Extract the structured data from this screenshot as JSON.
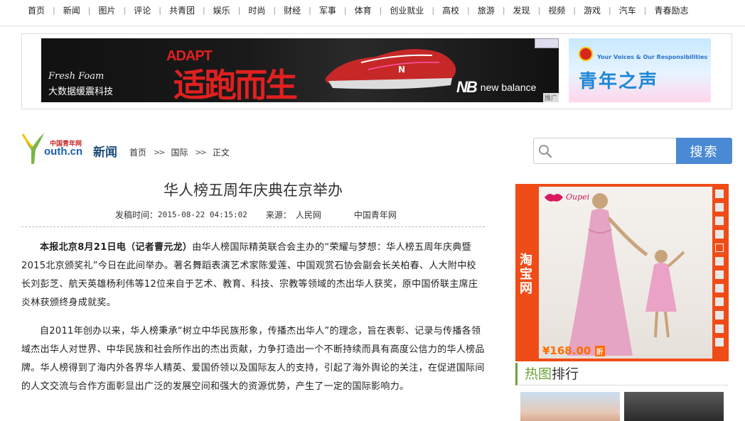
{
  "nav": {
    "items": [
      "首页",
      "新闻",
      "图片",
      "评论",
      "共青团",
      "娱乐",
      "时尚",
      "财经",
      "军事",
      "体育",
      "创业就业",
      "高校",
      "旅游",
      "发现",
      "视频",
      "游戏",
      "汽车",
      "青春励志"
    ]
  },
  "banner": {
    "main_ad": {
      "line1": "Fresh Foam",
      "line2": "大数据缓震科技",
      "adapt": "ADAPT",
      "slogan": "适跑而生",
      "brand": "new balance",
      "tag": "推广"
    },
    "side_ad": {
      "english": "Your Voices & Our Responsibilities",
      "title": "青年之声"
    }
  },
  "logo": {
    "top": "中国青年网",
    "text": "outh.cn"
  },
  "section": {
    "title": "新闻"
  },
  "breadcrumb": {
    "home": "首页",
    "sep": ">>",
    "section": "国际",
    "current": "正文"
  },
  "search": {
    "placeholder": "",
    "button": "搜索"
  },
  "article": {
    "title": "华人榜五周年庆典在京举办",
    "meta": {
      "time_label": "发稿时间：",
      "time": "2015-08-22 04:15:02",
      "source_label": "来源：",
      "source": "人民网",
      "site": "中国青年网"
    },
    "p1_lead": "本报北京8月21日电（记者曹元龙）",
    "p1_rest": "由华人榜国际精英联合会主办的“荣耀与梦想：华人榜五周年庆典暨2015北京颁奖礼”今日在此间举办。著名舞蹈表演艺术家陈爱莲、中国观赏石协会副会长关柏春、人大附中校长刘彭芝、航天英雄杨利伟等12位来自于艺术、教育、科技、宗教等领域的杰出华人获奖，原中国侨联主席庄炎林获颁终身成就奖。",
    "p2": "自2011年创办以来，华人榜秉承“树立中华民族形象，传播杰出华人”的理念，旨在表彰、记录与传播各领域杰出华人对世界、中华民族和社会所作出的杰出贡献，力争打造出一个不断持续而具有高度公信力的华人榜品牌。华人榜得到了海内外各界华人精英、爱国侨领以及国际友人的支持，引起了海外舆论的关注，在促进国际间的人文交流与合作方面彰显出广泛的发展空间和强大的资源优势，产生了一定的国际影响力。"
  },
  "taobao_ad": {
    "label": "淘宝网",
    "brand": "Oupei",
    "price": "¥168.00",
    "price_tag": "折",
    "active_index": 4,
    "dot_count": 12
  },
  "hot": {
    "green": "热图",
    "rest": "排行"
  },
  "colors": {
    "accent_blue": "#4a8ad4",
    "taobao_orange": "#f04c18",
    "hot_green": "#6aa23a",
    "ad_red": "#e02020"
  }
}
